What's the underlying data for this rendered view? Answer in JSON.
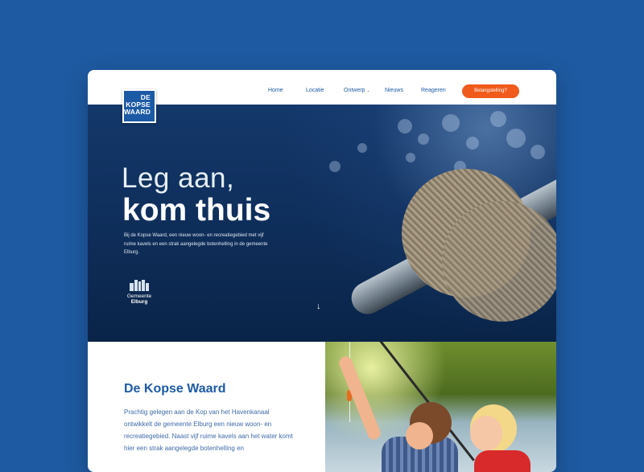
{
  "brand": {
    "logo_lines": [
      "DE",
      "KOPSE",
      "WAARD"
    ]
  },
  "nav": {
    "items": [
      {
        "label": "Home"
      },
      {
        "label": "Locatie"
      },
      {
        "label": "Ontwerp"
      },
      {
        "label": "Nieuws"
      },
      {
        "label": "Reageren"
      }
    ],
    "cta_label": "Belangstelling?"
  },
  "hero": {
    "title_light": "Leg aan,",
    "title_bold": "kom thuis",
    "text": "Bij de Kopse Waard, een nieuw woon- en recreatiegebied met vijf ruime kavels en een strak aangelegde botenhelling in de gemeente Elburg.",
    "partner_line1": "Gemeente",
    "partner_line2": "Elburg",
    "scroll_icon": "arrow-down-icon"
  },
  "intro": {
    "title": "De Kopse Waard",
    "body": "Prachtig gelegen aan de Kop van het Havenkanaal ontwikkelt de gemeente Elburg een nieuw woon- en recreatiegebied. Naast vijf ruime kavels aan het water komt hier een strak aangelegde botenhelling en"
  },
  "colors": {
    "background": "#1e5aa1",
    "brand_blue": "#1d5aa5",
    "cta_orange": "#f05a1a"
  }
}
